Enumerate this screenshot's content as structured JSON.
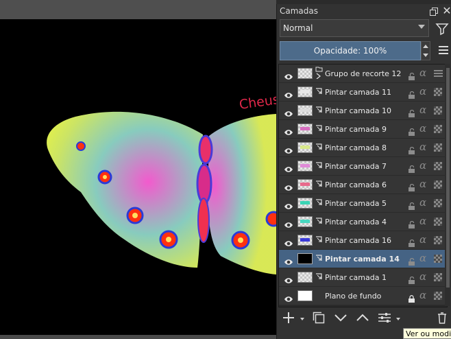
{
  "docker": {
    "title": "Camadas",
    "blend_mode": "Normal",
    "opacity_label": "Opacidade:  100%"
  },
  "canvas": {
    "signature_text": "Cheus"
  },
  "layers": [
    {
      "name": "Grupo de recorte 12",
      "kind": "group",
      "thumb": "checker",
      "locked": false,
      "active": false
    },
    {
      "name": "Pintar camada 11",
      "kind": "paint",
      "thumb": "checker",
      "mark": "#e8e8e8",
      "locked": false,
      "active": false
    },
    {
      "name": "Pintar camada 10",
      "kind": "paint",
      "thumb": "checker",
      "mark": "#dcdcdc",
      "locked": false,
      "active": false
    },
    {
      "name": "Pintar camada 9",
      "kind": "paint",
      "thumb": "checker",
      "mark": "#d86ec0",
      "locked": false,
      "active": false
    },
    {
      "name": "Pintar camada 8",
      "kind": "paint",
      "thumb": "checker",
      "mark": "#d8e88a",
      "locked": false,
      "active": false
    },
    {
      "name": "Pintar camada 7",
      "kind": "paint",
      "thumb": "checker",
      "mark": "#e08ad8",
      "locked": false,
      "active": false
    },
    {
      "name": "Pintar camada 6",
      "kind": "paint",
      "thumb": "checker",
      "mark": "#e86a8c",
      "locked": false,
      "active": false
    },
    {
      "name": "Pintar camada 5",
      "kind": "paint",
      "thumb": "checker",
      "mark": "#3ad4b4",
      "locked": false,
      "active": false
    },
    {
      "name": "Pintar camada 4",
      "kind": "paint",
      "thumb": "checker",
      "mark": "#48d8c0",
      "locked": false,
      "active": false
    },
    {
      "name": "Pintar camada 16",
      "kind": "paint",
      "thumb": "checker",
      "mark": "#3a3ad8",
      "locked": false,
      "active": false
    },
    {
      "name": "Pintar camada 14",
      "kind": "paint",
      "thumb": "black",
      "locked": false,
      "active": true
    },
    {
      "name": "Pintar camada 1",
      "kind": "paint",
      "thumb": "checker",
      "locked": false,
      "active": false
    },
    {
      "name": "Plano de fundo",
      "kind": "background",
      "thumb": "white",
      "locked": true,
      "active": false
    }
  ],
  "tooltip": "Ver ou modif",
  "colors": {
    "active_row": "#456384",
    "opacity_bar": "#4d6b8a",
    "signature": "#e0284a"
  }
}
